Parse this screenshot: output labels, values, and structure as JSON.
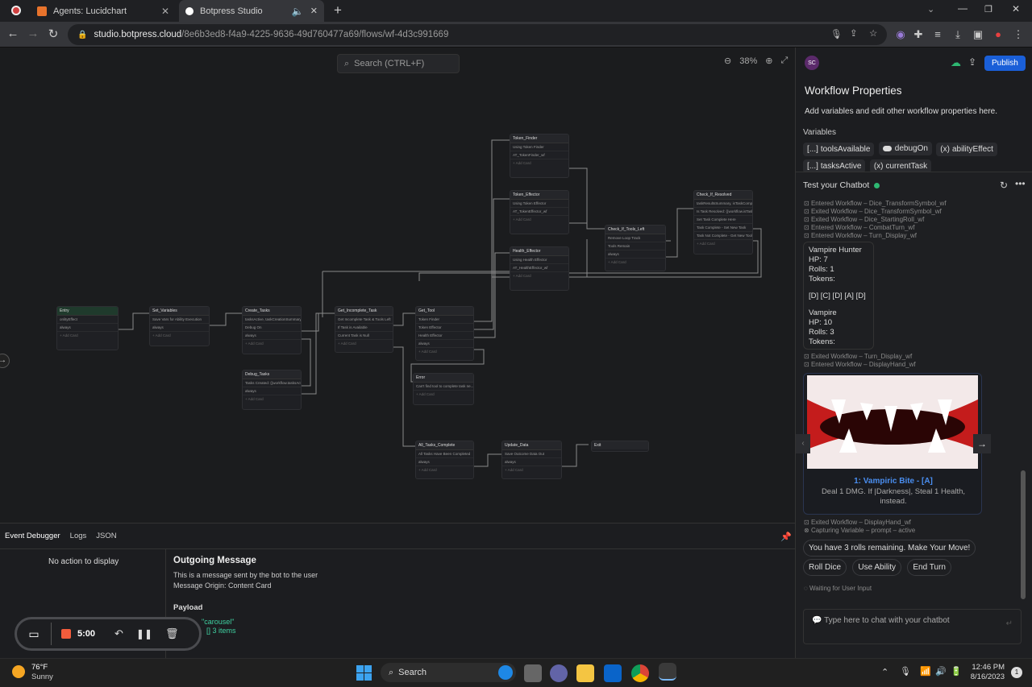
{
  "browser": {
    "tabs": [
      {
        "title": "Agents: Lucidchart",
        "active": false,
        "favicon_color": "#e8732c"
      },
      {
        "title": "Botpress Studio",
        "active": true,
        "favicon_color": "#ffffff"
      }
    ],
    "url_host": "studio.botpress.cloud",
    "url_path": "/8e6b3ed8-f4a9-4225-9636-49d760477a69/flows/wf-4d3c991669"
  },
  "canvas": {
    "search_placeholder": "Search (CTRL+F)",
    "zoom_level": "38%",
    "nodes": {
      "entry": {
        "title": "Entry",
        "rows": [
          "onlityEffect",
          "always"
        ],
        "add": "+ Add Card"
      },
      "set_variables": {
        "title": "Set_Variables",
        "rows": [
          "Save Vars for Ability Execution",
          "always"
        ],
        "add": "+ Add Card"
      },
      "create_tasks": {
        "title": "Create_Tasks",
        "rows": [
          "tasksActive, taskCreationSummary",
          "Debug On",
          "always"
        ],
        "add": "+ Add Card"
      },
      "debug_tasks": {
        "title": "Debug_Tasks",
        "rows": [
          "Tasks Created: {{workflow.tasksActi...",
          "always"
        ],
        "add": "+ Add Card"
      },
      "get_incomplete_task": {
        "title": "Get_Incomplete_Task",
        "rows": [
          "Get Incomplete Task & Tools Left",
          "If Task is Available",
          "Current Task is Null"
        ],
        "add": "+ Add Card"
      },
      "get_tool": {
        "title": "Get_Tool",
        "rows": [
          "Token Finder",
          "Token Effector",
          "Health Effector",
          "always"
        ],
        "add": "+ Add Card"
      },
      "error": {
        "title": "Error",
        "rows": [
          "Can't find tool to complete task ne..."
        ],
        "add": "+ Add Card"
      },
      "token_finder": {
        "title": "Token_Finder",
        "rows": [
          "Using Token Finder",
          "AT_TokenFinder_wf"
        ],
        "add": "+ Add Card"
      },
      "token_effector": {
        "title": "Token_Effector",
        "rows": [
          "Using Token Effector",
          "AT_TokenEffector_wf"
        ],
        "add": "+ Add Card"
      },
      "health_effector": {
        "title": "Health_Effector",
        "rows": [
          "Using Health Effector",
          "AT_HealthEffector_wf"
        ],
        "add": "+ Add Card"
      },
      "check_if_tools_left": {
        "title": "Check_If_Tools_Left",
        "rows": [
          "Remove Loop Track",
          "Tools Remain",
          "always"
        ],
        "add": "+ Add Card"
      },
      "check_if_resolved": {
        "title": "Check_If_Resolved",
        "rows": [
          "taskResultsSummary, isTaskComp...",
          "Is Task Resolved: {{workflow.isTask...",
          "Set Task Complete Here",
          "Task Complete - Set New Task",
          "Task Not Complete - Get New Tool"
        ],
        "add": "+ Add Card"
      },
      "all_tasks_complete": {
        "title": "All_Tasks_Complete",
        "rows": [
          "All Tasks Have Been Completed",
          "always"
        ],
        "add": "+ Add Card"
      },
      "update_data": {
        "title": "Update_Data",
        "rows": [
          "Save Outcome Data Out",
          "always"
        ],
        "add": "+ Add Card"
      },
      "exit": {
        "title": "Exit",
        "rows": [],
        "add": ""
      }
    }
  },
  "workflow_props": {
    "avatar": "SC",
    "publish_label": "Publish",
    "title": "Workflow Properties",
    "description": "Add variables and edit other workflow properties here.",
    "variables_label": "Variables",
    "variables": [
      {
        "prefix": "[...]",
        "name": "toolsAvailable"
      },
      {
        "prefix": "toggle",
        "name": "debugOn"
      },
      {
        "prefix": "(x)",
        "name": "abilityEffect"
      },
      {
        "prefix": "[...]",
        "name": "tasksActive"
      },
      {
        "prefix": "(x)",
        "name": "currentTask"
      }
    ]
  },
  "chat": {
    "title": "Test your Chatbot",
    "logs_top": [
      "Entered Workflow – Dice_TransformSymbol_wf",
      "Exited Workflow – Dice_TransformSymbol_wf",
      "Exited Workflow – Dice_StartingRoll_wf",
      "Entered Workflow – CombatTurn_wf",
      "Entered Workflow – Turn_Display_wf"
    ],
    "status_card": {
      "line1": "Vampire Hunter",
      "line2": "HP: 7",
      "line3": "Rolls: 1",
      "line4": "Tokens:",
      "line5": "[D] [C] [D] [A] [D]",
      "line6": "Vampire",
      "line7": "HP: 10",
      "line8": "Rolls: 3",
      "line9": "Tokens:"
    },
    "logs_mid": [
      "Exited Workflow – Turn_Display_wf",
      "Entered Workflow – DisplayHand_wf"
    ],
    "card_title": "1: Vampiric Bite - [A]",
    "card_desc": "Deal 1 DMG. If |Darkness|, Steal 1 Health, instead.",
    "logs_bottom": [
      "Exited Workflow – DisplayHand_wf",
      "Capturing Variable – prompt – active"
    ],
    "bot_message": "You have 3 rolls remaining. Make Your Move!",
    "choices": [
      "Roll Dice",
      "Use Ability",
      "End Turn"
    ],
    "waiting": "Waiting for User Input",
    "input_placeholder": "Type here to chat with your chatbot"
  },
  "debugger": {
    "tabs": [
      "Event Debugger",
      "Logs",
      "JSON"
    ],
    "no_action": "No action to display",
    "heading": "Outgoing Message",
    "desc1": "This is a message sent by the bot to the user",
    "desc2": "Message Origin: Content Card",
    "payload_label": "Payload",
    "payload_type": "\"carousel\"",
    "payload_items": "[]  3 items"
  },
  "recorder": {
    "time": "5:00"
  },
  "taskbar": {
    "weather_temp": "76°F",
    "weather_desc": "Sunny",
    "search_label": "Search",
    "time": "12:46 PM",
    "date": "8/16/2023",
    "notif_count": "1"
  }
}
